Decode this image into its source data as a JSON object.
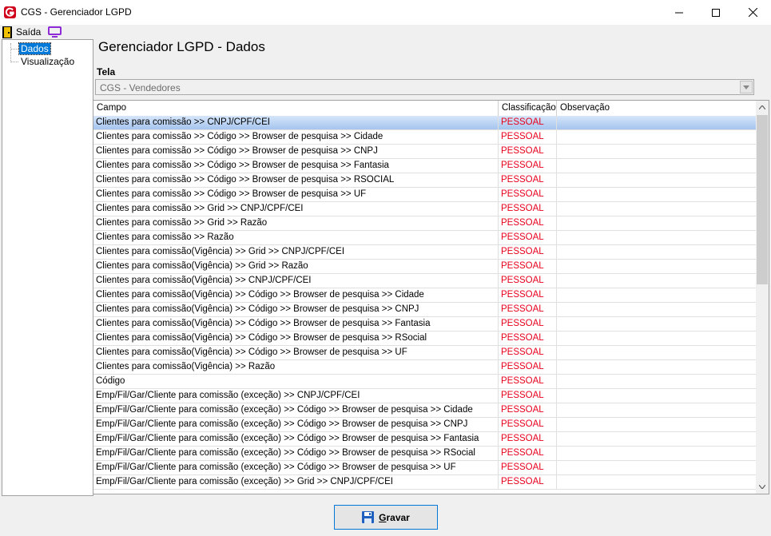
{
  "window": {
    "title": "CGS - Gerenciador LGPD"
  },
  "menu": {
    "exit_label": "Saída"
  },
  "tree": {
    "items": [
      {
        "label": "Dados",
        "selected": true
      },
      {
        "label": "Visualização",
        "selected": false
      }
    ]
  },
  "main": {
    "page_title": "Gerenciador LGPD - Dados",
    "tela_label": "Tela",
    "tela_value": "CGS - Vendedores"
  },
  "grid": {
    "columns": [
      "Campo",
      "Classificação",
      "Observação"
    ],
    "rows": [
      {
        "campo": "Clientes para comissão >> CNPJ/CPF/CEI",
        "classificacao": "PESSOAL",
        "observacao": ""
      },
      {
        "campo": "Clientes para comissão >> Código >> Browser de pesquisa >> Cidade",
        "classificacao": "PESSOAL",
        "observacao": ""
      },
      {
        "campo": "Clientes para comissão >> Código >> Browser de pesquisa >> CNPJ",
        "classificacao": "PESSOAL",
        "observacao": ""
      },
      {
        "campo": "Clientes para comissão >> Código >> Browser de pesquisa >> Fantasia",
        "classificacao": "PESSOAL",
        "observacao": ""
      },
      {
        "campo": "Clientes para comissão >> Código >> Browser de pesquisa >> RSOCIAL",
        "classificacao": "PESSOAL",
        "observacao": ""
      },
      {
        "campo": "Clientes para comissão >> Código >> Browser de pesquisa >> UF",
        "classificacao": "PESSOAL",
        "observacao": ""
      },
      {
        "campo": "Clientes para comissão >> Grid >> CNPJ/CPF/CEI",
        "classificacao": "PESSOAL",
        "observacao": ""
      },
      {
        "campo": "Clientes para comissão >> Grid >> Razão",
        "classificacao": "PESSOAL",
        "observacao": ""
      },
      {
        "campo": "Clientes para comissão >> Razão",
        "classificacao": "PESSOAL",
        "observacao": ""
      },
      {
        "campo": "Clientes para comissão(Vigência)  >> Grid >> CNPJ/CPF/CEI",
        "classificacao": "PESSOAL",
        "observacao": ""
      },
      {
        "campo": "Clientes para comissão(Vigência)  >> Grid >> Razão",
        "classificacao": "PESSOAL",
        "observacao": ""
      },
      {
        "campo": "Clientes para comissão(Vigência) >> CNPJ/CPF/CEI",
        "classificacao": "PESSOAL",
        "observacao": ""
      },
      {
        "campo": "Clientes para comissão(Vigência) >> Código >> Browser de pesquisa >> Cidade",
        "classificacao": "PESSOAL",
        "observacao": ""
      },
      {
        "campo": "Clientes para comissão(Vigência) >> Código >> Browser de pesquisa >> CNPJ",
        "classificacao": "PESSOAL",
        "observacao": ""
      },
      {
        "campo": "Clientes para comissão(Vigência) >> Código >> Browser de pesquisa >> Fantasia",
        "classificacao": "PESSOAL",
        "observacao": ""
      },
      {
        "campo": "Clientes para comissão(Vigência) >> Código >> Browser de pesquisa >> RSocial",
        "classificacao": "PESSOAL",
        "observacao": ""
      },
      {
        "campo": "Clientes para comissão(Vigência) >> Código >> Browser de pesquisa >> UF",
        "classificacao": "PESSOAL",
        "observacao": ""
      },
      {
        "campo": "Clientes para comissão(Vigência) >> Razão",
        "classificacao": "PESSOAL",
        "observacao": ""
      },
      {
        "campo": "Código",
        "classificacao": "PESSOAL",
        "observacao": ""
      },
      {
        "campo": "Emp/Fil/Gar/Cliente para comissão (exceção) >> CNPJ/CPF/CEI",
        "classificacao": "PESSOAL",
        "observacao": ""
      },
      {
        "campo": "Emp/Fil/Gar/Cliente para comissão (exceção) >> Código >> Browser de pesquisa >> Cidade",
        "classificacao": "PESSOAL",
        "observacao": ""
      },
      {
        "campo": "Emp/Fil/Gar/Cliente para comissão (exceção) >> Código >> Browser de pesquisa >> CNPJ",
        "classificacao": "PESSOAL",
        "observacao": ""
      },
      {
        "campo": "Emp/Fil/Gar/Cliente para comissão (exceção) >> Código >> Browser de pesquisa >> Fantasia",
        "classificacao": "PESSOAL",
        "observacao": ""
      },
      {
        "campo": "Emp/Fil/Gar/Cliente para comissão (exceção) >> Código >> Browser de pesquisa >> RSocial",
        "classificacao": "PESSOAL",
        "observacao": ""
      },
      {
        "campo": "Emp/Fil/Gar/Cliente para comissão (exceção) >> Código >> Browser de pesquisa >> UF",
        "classificacao": "PESSOAL",
        "observacao": ""
      },
      {
        "campo": "Emp/Fil/Gar/Cliente para comissão (exceção) >> Grid >> CNPJ/CPF/CEI",
        "classificacao": "PESSOAL",
        "observacao": ""
      }
    ],
    "selected_row": 0
  },
  "actions": {
    "save_label": "Gravar",
    "save_accel": "G"
  },
  "colors": {
    "classification_text": "#e8001c",
    "selection": "#0078d7",
    "logo": "#d0021b"
  }
}
